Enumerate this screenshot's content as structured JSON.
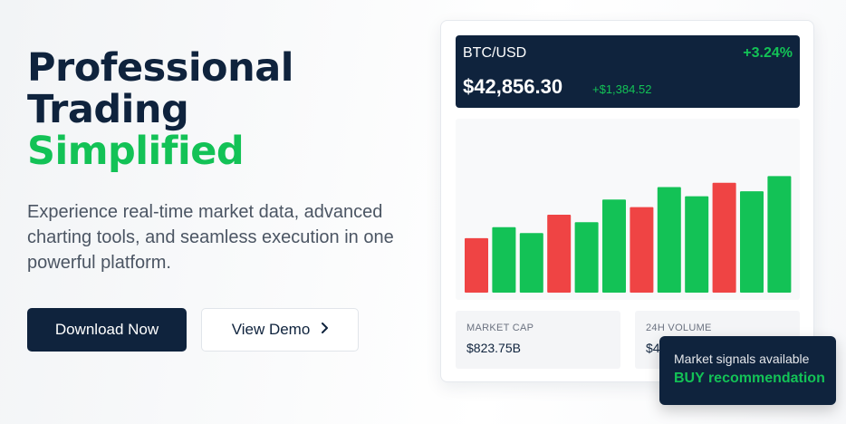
{
  "hero": {
    "title_line1": "Professional",
    "title_line2": "Trading",
    "title_accent": "Simplified",
    "subtitle": "Experience real-time market data, advanced charting tools, and seamless execution in one powerful platform."
  },
  "buttons": {
    "download": "Download Now",
    "demo": "View Demo",
    "demo_icon": "chevron-right-icon"
  },
  "ticker": {
    "pair": "BTC/USD",
    "change_pct": "+3.24%",
    "price": "$42,856.30",
    "change_abs": "+$1,384.52"
  },
  "stats": {
    "market_cap_label": "MARKET CAP",
    "market_cap_value": "$823.75B",
    "volume_label": "24H VOLUME",
    "volume_value": "$4"
  },
  "toast": {
    "message": "Market signals available",
    "recommendation": "BUY recommendation"
  },
  "colors": {
    "navy": "#0f233d",
    "green": "#13c256",
    "red": "#ef4444"
  },
  "chart_data": {
    "type": "bar",
    "values": [
      65,
      78,
      71,
      93,
      84,
      111,
      102,
      126,
      115,
      131,
      121,
      139
    ],
    "directions": [
      "down",
      "up",
      "up",
      "down",
      "up",
      "up",
      "down",
      "up",
      "up",
      "down",
      "up",
      "up"
    ],
    "ylim": [
      0,
      200
    ],
    "grid": false,
    "title": "",
    "xlabel": "",
    "ylabel": ""
  }
}
